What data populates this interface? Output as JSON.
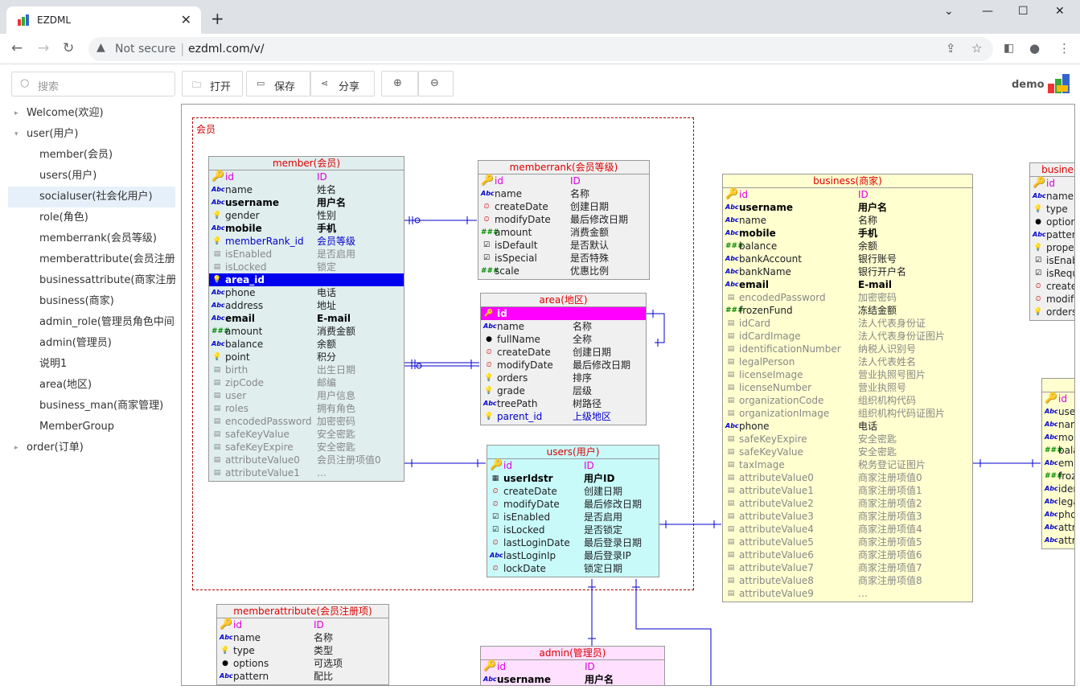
{
  "browser": {
    "tab_title": "EZDML",
    "close": "✕",
    "new_tab": "+",
    "not_secure": "Not secure",
    "url": "ezdml.com/v/"
  },
  "toolbar": {
    "search_placeholder": "搜索",
    "open": "打开",
    "save": "保存",
    "share": "分享",
    "user": "demo"
  },
  "sidebar": {
    "items": [
      {
        "label": "Welcome(欢迎)",
        "level": 0,
        "caret": "▸"
      },
      {
        "label": "user(用户)",
        "level": 0,
        "caret": "▾"
      },
      {
        "label": "member(会员)",
        "level": 1
      },
      {
        "label": "users(用户)",
        "level": 1
      },
      {
        "label": "socialuser(社会化用户)",
        "level": 1,
        "selected": true
      },
      {
        "label": "role(角色)",
        "level": 1
      },
      {
        "label": "memberrank(会员等级)",
        "level": 1
      },
      {
        "label": "memberattribute(会员注册项)",
        "level": 1
      },
      {
        "label": "businessattribute(商家注册项)",
        "level": 1
      },
      {
        "label": "business(商家)",
        "level": 1
      },
      {
        "label": "admin_role(管理员角色中间表)",
        "level": 1
      },
      {
        "label": "admin(管理员)",
        "level": 1
      },
      {
        "label": "说明1",
        "level": 1
      },
      {
        "label": "area(地区)",
        "level": 1
      },
      {
        "label": "business_man(商家管理)",
        "level": 1
      },
      {
        "label": "MemberGroup",
        "level": 1
      },
      {
        "label": "order(订单)",
        "level": 0,
        "caret": "▸"
      }
    ]
  },
  "group": {
    "label": "会员"
  },
  "colors": {
    "member_bg": "#e0eeee",
    "memberrank_bg": "#f0f0f0",
    "area_bg": "#f0f0f0",
    "users_bg": "#c8fafa",
    "business_bg": "#ffffd0",
    "admin_bg": "#ffe0ff",
    "memberattr_bg": "#f0f0f0"
  },
  "tables": {
    "member": {
      "title": "member(会员)",
      "rows": [
        [
          "id",
          "ID",
          "t-key",
          "pk"
        ],
        [
          "name",
          "姓名",
          "t-abc",
          ""
        ],
        [
          "username",
          "用户名",
          "t-abc",
          "bold"
        ],
        [
          "gender",
          "性别",
          "t-idx",
          ""
        ],
        [
          "mobile",
          "手机",
          "t-abc",
          "bold"
        ],
        [
          "memberRank_id",
          "会员等级",
          "t-idx",
          "fk"
        ],
        [
          "isEnabled",
          "是否启用",
          "t-dis",
          "dim"
        ],
        [
          "isLocked",
          "锁定",
          "t-dis",
          "dim"
        ],
        [
          "area_id",
          "",
          "t-idx",
          "hl"
        ],
        [
          "phone",
          "电话",
          "t-abc",
          ""
        ],
        [
          "address",
          "地址",
          "t-abc",
          ""
        ],
        [
          "email",
          "E-mail",
          "t-abc",
          "bold"
        ],
        [
          "amount",
          "消费金额",
          "t-num",
          ""
        ],
        [
          "balance",
          "余额",
          "t-abc",
          ""
        ],
        [
          "point",
          "积分",
          "t-idx",
          ""
        ],
        [
          "birth",
          "出生日期",
          "t-dis",
          "dim"
        ],
        [
          "zipCode",
          "邮编",
          "t-dis",
          "dim"
        ],
        [
          "user",
          "用户信息",
          "t-dis",
          "dim"
        ],
        [
          "roles",
          "拥有角色",
          "t-dis",
          "dim"
        ],
        [
          "encodedPassword",
          "加密密码",
          "t-dis",
          "dim"
        ],
        [
          "safeKeyValue",
          "安全密匙",
          "t-dis",
          "dim"
        ],
        [
          "safeKeyExpire",
          "安全密匙",
          "t-dis",
          "dim"
        ],
        [
          "attributeValue0",
          "会员注册项值0",
          "t-dis",
          "dim"
        ],
        [
          "attributeValue1",
          "…",
          "t-dis",
          "dim"
        ]
      ]
    },
    "memberrank": {
      "title": "memberrank(会员等级)",
      "rows": [
        [
          "id",
          "ID",
          "t-key",
          "pk"
        ],
        [
          "name",
          "名称",
          "t-abc",
          ""
        ],
        [
          "createDate",
          "创建日期",
          "t-time",
          ""
        ],
        [
          "modifyDate",
          "最后修改日期",
          "t-time",
          ""
        ],
        [
          "amount",
          "消费金额",
          "t-num",
          ""
        ],
        [
          "isDefault",
          "是否默认",
          "t-chk",
          ""
        ],
        [
          "isSpecial",
          "是否特殊",
          "t-chk",
          ""
        ],
        [
          "scale",
          "优惠比例",
          "t-num",
          ""
        ]
      ]
    },
    "area": {
      "title": "area(地区)",
      "rows": [
        [
          "id",
          "",
          "t-key",
          "hlm"
        ],
        [
          "name",
          "名称",
          "t-abc",
          ""
        ],
        [
          "fullName",
          "全称",
          "t-dot",
          ""
        ],
        [
          "createDate",
          "创建日期",
          "t-time",
          ""
        ],
        [
          "modifyDate",
          "最后修改日期",
          "t-time",
          ""
        ],
        [
          "orders",
          "排序",
          "t-idx",
          ""
        ],
        [
          "grade",
          "层级",
          "t-idx",
          ""
        ],
        [
          "treePath",
          "树路径",
          "t-abc",
          ""
        ],
        [
          "parent_id",
          "上级地区",
          "t-idx",
          "fk"
        ]
      ]
    },
    "users": {
      "title": "users(用户)",
      "rows": [
        [
          "id",
          "ID",
          "t-key",
          "pk"
        ],
        [
          "userIdstr",
          "用户ID",
          "t-calc",
          "bold"
        ],
        [
          "createDate",
          "创建日期",
          "t-time",
          ""
        ],
        [
          "modifyDate",
          "最后修改日期",
          "t-time",
          ""
        ],
        [
          "isEnabled",
          "是否启用",
          "t-chk",
          ""
        ],
        [
          "isLocked",
          "是否锁定",
          "t-chk",
          ""
        ],
        [
          "lastLoginDate",
          "最后登录日期",
          "t-time",
          ""
        ],
        [
          "lastLoginIp",
          "最后登录IP",
          "t-abc",
          ""
        ],
        [
          "lockDate",
          "锁定日期",
          "t-time",
          ""
        ]
      ]
    },
    "business": {
      "title": "business(商家)",
      "rows": [
        [
          "id",
          "ID",
          "t-key",
          "pk"
        ],
        [
          "username",
          "用户名",
          "t-abc",
          "bold"
        ],
        [
          "name",
          "名称",
          "t-abc",
          ""
        ],
        [
          "mobile",
          "手机",
          "t-abc",
          "bold"
        ],
        [
          "balance",
          "余额",
          "t-num",
          ""
        ],
        [
          "bankAccount",
          "银行账号",
          "t-abc",
          ""
        ],
        [
          "bankName",
          "银行开户名",
          "t-abc",
          ""
        ],
        [
          "email",
          "E-mail",
          "t-abc",
          "bold"
        ],
        [
          "encodedPassword",
          "加密密码",
          "t-dis",
          "dim"
        ],
        [
          "frozenFund",
          "冻结金额",
          "t-num",
          ""
        ],
        [
          "idCard",
          "法人代表身份证",
          "t-dis",
          "dim"
        ],
        [
          "idCardImage",
          "法人代表身份证图片",
          "t-dis",
          "dim"
        ],
        [
          "identificationNumber",
          "纳税人识别号",
          "t-dis",
          "dim"
        ],
        [
          "legalPerson",
          "法人代表姓名",
          "t-dis",
          "dim"
        ],
        [
          "licenseImage",
          "营业执照号图片",
          "t-dis",
          "dim"
        ],
        [
          "licenseNumber",
          "营业执照号",
          "t-dis",
          "dim"
        ],
        [
          "organizationCode",
          "组织机构代码",
          "t-dis",
          "dim"
        ],
        [
          "organizationImage",
          "组织机构代码证图片",
          "t-dis",
          "dim"
        ],
        [
          "phone",
          "电话",
          "t-abc",
          ""
        ],
        [
          "safeKeyExpire",
          "安全密匙",
          "t-dis",
          "dim"
        ],
        [
          "safeKeyValue",
          "安全密匙",
          "t-dis",
          "dim"
        ],
        [
          "taxImage",
          "税务登记证图片",
          "t-dis",
          "dim"
        ],
        [
          "attributeValue0",
          "商家注册项值0",
          "t-dis",
          "dim"
        ],
        [
          "attributeValue1",
          "商家注册项值1",
          "t-dis",
          "dim"
        ],
        [
          "attributeValue2",
          "商家注册项值2",
          "t-dis",
          "dim"
        ],
        [
          "attributeValue3",
          "商家注册项值3",
          "t-dis",
          "dim"
        ],
        [
          "attributeValue4",
          "商家注册项值4",
          "t-dis",
          "dim"
        ],
        [
          "attributeValue5",
          "商家注册项值5",
          "t-dis",
          "dim"
        ],
        [
          "attributeValue6",
          "商家注册项值6",
          "t-dis",
          "dim"
        ],
        [
          "attributeValue7",
          "商家注册项值7",
          "t-dis",
          "dim"
        ],
        [
          "attributeValue8",
          "商家注册项值8",
          "t-dis",
          "dim"
        ],
        [
          "attributeValue9",
          "…",
          "t-dis",
          "dim"
        ]
      ]
    },
    "businessattr": {
      "title": "busine",
      "rows": [
        [
          "id",
          "",
          "t-key",
          "pk"
        ],
        [
          "name",
          "",
          "t-abc",
          ""
        ],
        [
          "type",
          "",
          "t-idx",
          ""
        ],
        [
          "option",
          "",
          "t-dot",
          ""
        ],
        [
          "patterr",
          "",
          "t-abc",
          ""
        ],
        [
          "proper",
          "",
          "t-idx",
          ""
        ],
        [
          "isEnab",
          "",
          "t-chk",
          ""
        ],
        [
          "isRequ",
          "",
          "t-chk",
          ""
        ],
        [
          "create",
          "",
          "t-time",
          ""
        ],
        [
          "modify",
          "",
          "t-time",
          ""
        ],
        [
          "orders",
          "",
          "t-idx",
          ""
        ]
      ]
    },
    "businessman": {
      "title": "",
      "rows": [
        [
          "id",
          "",
          "t-key",
          "pk"
        ],
        [
          "user",
          "",
          "t-abc",
          ""
        ],
        [
          "nam",
          "",
          "t-abc",
          ""
        ],
        [
          "mob",
          "",
          "t-abc",
          ""
        ],
        [
          "bala",
          "",
          "t-num",
          ""
        ],
        [
          "ema",
          "",
          "t-abc",
          ""
        ],
        [
          "froz",
          "",
          "t-num",
          ""
        ],
        [
          "ider",
          "",
          "t-abc",
          ""
        ],
        [
          "lega",
          "",
          "t-abc",
          ""
        ],
        [
          "pho",
          "",
          "t-abc",
          ""
        ],
        [
          "attri",
          "",
          "t-abc",
          ""
        ],
        [
          "attri",
          "",
          "t-abc",
          ""
        ]
      ]
    },
    "memberattr": {
      "title": "memberattribute(会员注册项)",
      "rows": [
        [
          "id",
          "ID",
          "t-key",
          "pk"
        ],
        [
          "name",
          "名称",
          "t-abc",
          ""
        ],
        [
          "type",
          "类型",
          "t-idx",
          ""
        ],
        [
          "options",
          "可选项",
          "t-dot",
          ""
        ],
        [
          "pattern",
          "配比",
          "t-abc",
          ""
        ]
      ]
    },
    "admin": {
      "title": "admin(管理员)",
      "rows": [
        [
          "id",
          "ID",
          "t-key",
          "pk"
        ],
        [
          "username",
          "用户名",
          "t-abc",
          "bold"
        ]
      ]
    }
  }
}
